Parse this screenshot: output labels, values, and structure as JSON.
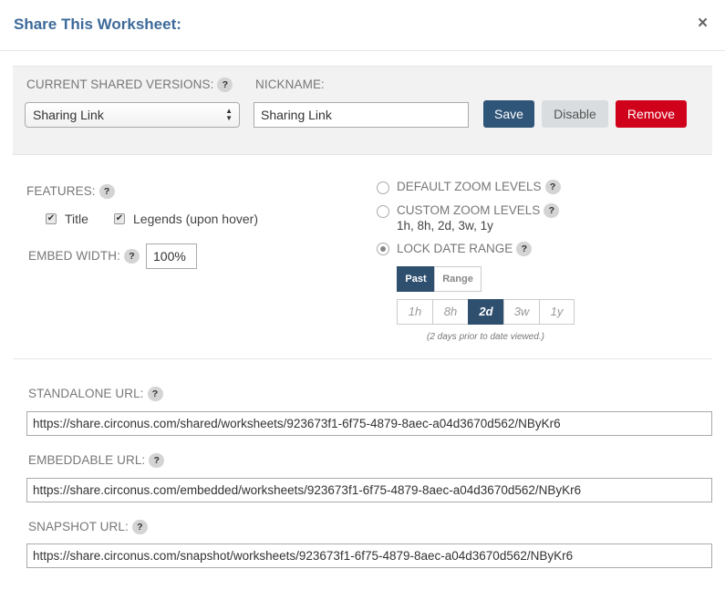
{
  "dialog": {
    "title": "Share This Worksheet:",
    "close_glyph": "×"
  },
  "versions": {
    "label": "CURRENT SHARED VERSIONS:",
    "help": "?",
    "selected": "Sharing Link",
    "arrows": "▲▼"
  },
  "nickname": {
    "label": "NICKNAME:",
    "value": "Sharing Link"
  },
  "buttons": {
    "save": "Save",
    "disable": "Disable",
    "remove": "Remove"
  },
  "features": {
    "label": "FEATURES:",
    "help": "?",
    "items": [
      {
        "label": "Title",
        "checked": true,
        "mark": "✔"
      },
      {
        "label": "Legends (upon hover)",
        "checked": true,
        "mark": "✔"
      }
    ]
  },
  "embed_width": {
    "label": "EMBED WIDTH:",
    "help": "?",
    "value": "100%"
  },
  "zoom_options": {
    "default": {
      "label": "DEFAULT ZOOM LEVELS",
      "help": "?",
      "selected": false
    },
    "custom": {
      "label": "CUSTOM ZOOM LEVELS",
      "help": "?",
      "selected": false,
      "levels": "1h, 8h, 2d, 3w, 1y"
    },
    "lock": {
      "label": "LOCK DATE RANGE",
      "help": "?",
      "selected": true
    }
  },
  "range_mode": {
    "options": [
      "Past",
      "Range"
    ],
    "selected": "Past"
  },
  "zoom_levels": {
    "options": [
      "1h",
      "8h",
      "2d",
      "3w",
      "1y"
    ],
    "selected": "2d",
    "note": "(2 days prior to date viewed.)"
  },
  "urls": {
    "standalone": {
      "label": "STANDALONE URL:",
      "help": "?",
      "value": "https://share.circonus.com/shared/worksheets/923673f1-6f75-4879-8aec-a04d3670d562/NByKr6"
    },
    "embeddable": {
      "label": "EMBEDDABLE URL:",
      "help": "?",
      "value": "https://share.circonus.com/embedded/worksheets/923673f1-6f75-4879-8aec-a04d3670d562/NByKr6"
    },
    "snapshot": {
      "label": "SNAPSHOT URL:",
      "help": "?",
      "value": "https://share.circonus.com/snapshot/worksheets/923673f1-6f75-4879-8aec-a04d3670d562/NByKr6"
    }
  },
  "colors": {
    "title": "#3d6a9a",
    "save": "#2f5578",
    "remove": "#d0021b",
    "active_segment": "#2f4f6f"
  }
}
